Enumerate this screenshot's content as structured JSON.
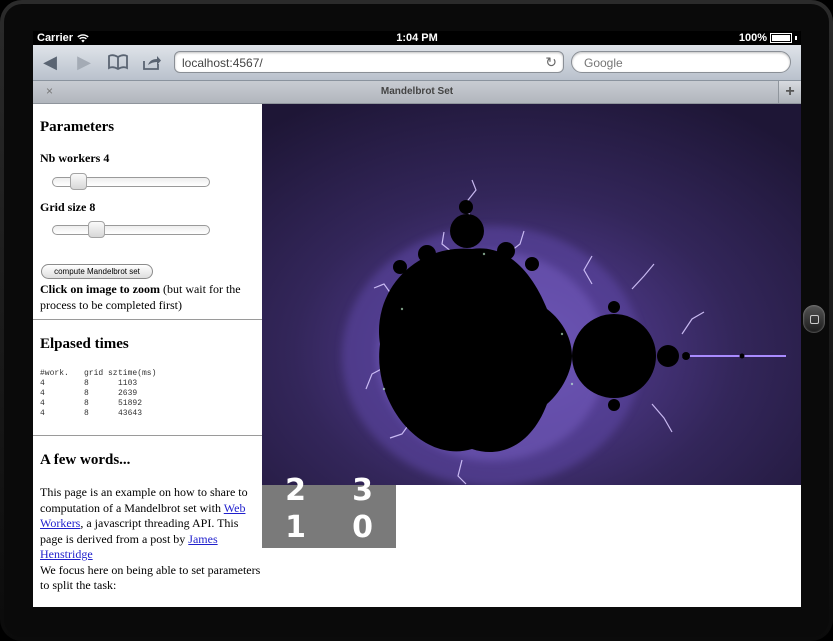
{
  "status": {
    "carrier": "Carrier",
    "time": "1:04 PM",
    "battery": "100%"
  },
  "browser": {
    "url": "localhost:4567/",
    "search_placeholder": "Google",
    "tab_title": "Mandelbrot Set",
    "tab_close": "×",
    "new_tab": "+",
    "back": "◀",
    "forward": "▶",
    "reload": "↻"
  },
  "panel": {
    "parameters_heading": "Parameters",
    "workers": {
      "label": "Nb workers",
      "value": "4",
      "slider_fraction": 0.12
    },
    "grid": {
      "label": "Grid size",
      "value": "8",
      "slider_fraction": 0.25
    },
    "compute_button": "compute Mandelbrot set",
    "instruction_bold": "Click on image to zoom",
    "instruction_rest": " (but wait for the process to be completed first)",
    "elapsed_heading": "Elpased times",
    "table_headers": [
      "#work.",
      "grid sz",
      "time(ms)"
    ],
    "table_rows": [
      [
        "4",
        "8",
        "1103"
      ],
      [
        "4",
        "8",
        "2639"
      ],
      [
        "4",
        "8",
        "51892"
      ],
      [
        "4",
        "8",
        "43643"
      ]
    ],
    "words_heading": "A few words...",
    "p1_a": "This page is an example on how to share to computation of a Mandelbrot set with ",
    "link_web_workers": "Web Workers",
    "p1_b": ", a javascript threading API. This page is derived from a post by ",
    "link_author": "James Henstridge",
    "p2": "We focus here on being able to set parameters to split the task:"
  },
  "quadrants": {
    "top_left": "2",
    "top_right": "3",
    "bottom_left": "1",
    "bottom_right": "0"
  },
  "colors": {
    "fractal_bg": "#2e2248",
    "fractal_glow": "#8a6bd6",
    "grid_bg": "#7a7a7a",
    "link": "#1f1fcc"
  }
}
